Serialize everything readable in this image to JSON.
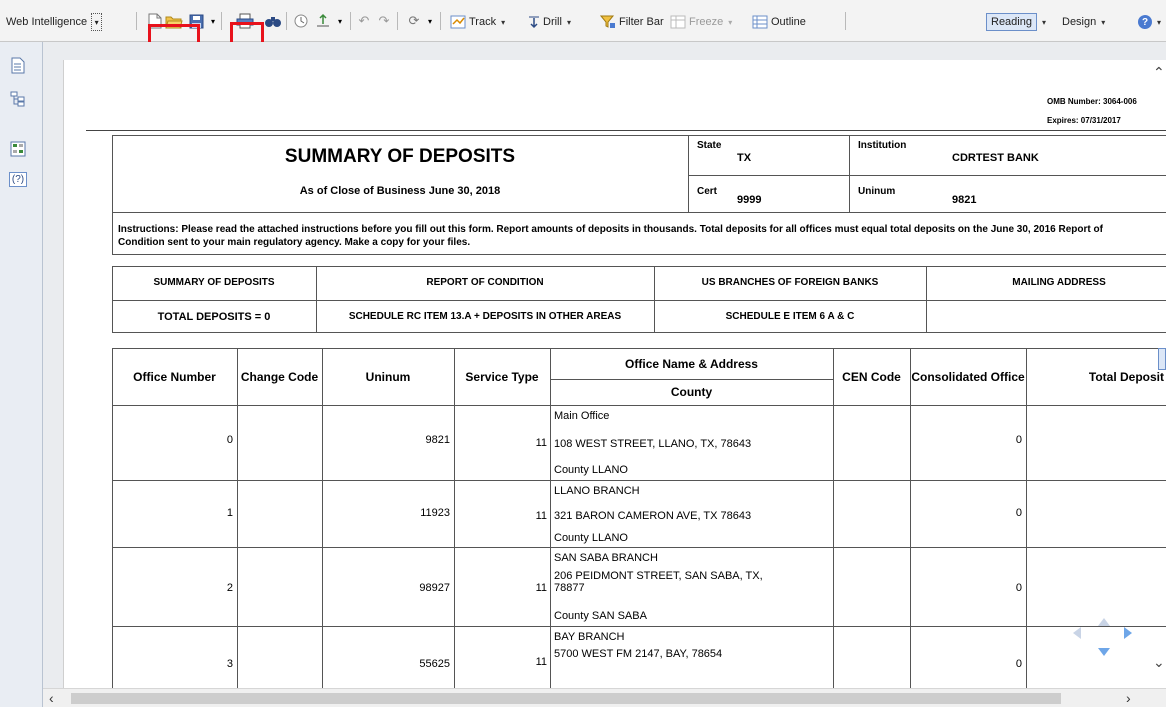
{
  "toolbar": {
    "app_name": "Web Intelligence",
    "track_label": "Track",
    "drill_label": "Drill",
    "filter_bar_label": "Filter Bar",
    "freeze_label": "Freeze",
    "outline_label": "Outline",
    "reading_label": "Reading",
    "design_label": "Design"
  },
  "report": {
    "omb_number": "OMB Number: 3064-006",
    "expires": "Expires: 07/31/2017",
    "title": "SUMMARY OF DEPOSITS",
    "as_of": "As of Close of Business June 30, 2018",
    "state_label": "State",
    "state_value": "TX",
    "institution_label": "Institution",
    "institution_value": "CDRTEST BANK",
    "cert_label": "Cert",
    "cert_value": "9999",
    "uninum_label": "Uninum",
    "uninum_value": "9821",
    "instructions": "Instructions: Please read the attached instructions before you fill out this form. Report amounts of deposits in thousands. Total deposits for all offices must equal total deposits on the June 30, 2016 Report of Condition sent to your main regulatory agency. Make a copy for your files.",
    "summary_headers": [
      "SUMMARY OF DEPOSITS",
      "REPORT OF CONDITION",
      "US BRANCHES OF FOREIGN BANKS",
      "MAILING ADDRESS"
    ],
    "summary_values": [
      "TOTAL DEPOSITS = 0",
      "SCHEDULE RC ITEM 13.A + DEPOSITS IN OTHER AREAS",
      "SCHEDULE E ITEM 6 A & C",
      ""
    ],
    "columns": {
      "office_number": "Office Number",
      "change_code": "Change Code",
      "uninum": "Uninum",
      "service_type": "Service Type",
      "office_name_address": "Office Name & Address",
      "county": "County",
      "cen_code": "CEN Code",
      "consolidated_office": "Consolidated Office",
      "total_deposit": "Total Deposit"
    },
    "rows": [
      {
        "office": "0",
        "uninum": "9821",
        "service": "11",
        "name": "Main Office",
        "address": "108 WEST  STREET, LLANO, TX, 78643",
        "county": "County  LLANO",
        "consolidated": "0"
      },
      {
        "office": "1",
        "uninum": "11923",
        "service": "11",
        "name": "LLANO BRANCH",
        "address": "321 BARON CAMERON AVE, TX 78643",
        "county": "County  LLANO",
        "consolidated": "0"
      },
      {
        "office": "2",
        "uninum": "98927",
        "service": "11",
        "name": "SAN SABA BRANCH",
        "address": "206 PEIDMONT STREET, SAN SABA, TX, 78877",
        "county": "County  SAN SABA",
        "consolidated": "0"
      },
      {
        "office": "3",
        "uninum": "55625",
        "service": "11",
        "name": "BAY BRANCH",
        "address": "5700 WEST FM 2147, BAY, 78654",
        "county": "",
        "consolidated": "0"
      }
    ]
  }
}
